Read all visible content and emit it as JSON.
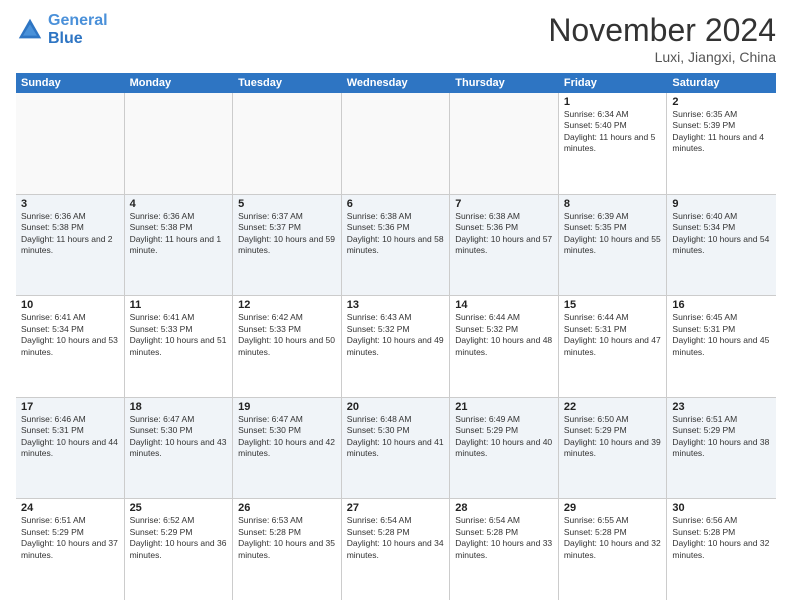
{
  "logo": {
    "line1": "General",
    "line2": "Blue"
  },
  "title": "November 2024",
  "location": "Luxi, Jiangxi, China",
  "weekdays": [
    "Sunday",
    "Monday",
    "Tuesday",
    "Wednesday",
    "Thursday",
    "Friday",
    "Saturday"
  ],
  "rows": [
    [
      {
        "day": "",
        "info": "",
        "empty": true
      },
      {
        "day": "",
        "info": "",
        "empty": true
      },
      {
        "day": "",
        "info": "",
        "empty": true
      },
      {
        "day": "",
        "info": "",
        "empty": true
      },
      {
        "day": "",
        "info": "",
        "empty": true
      },
      {
        "day": "1",
        "info": "Sunrise: 6:34 AM\nSunset: 5:40 PM\nDaylight: 11 hours and 5 minutes."
      },
      {
        "day": "2",
        "info": "Sunrise: 6:35 AM\nSunset: 5:39 PM\nDaylight: 11 hours and 4 minutes."
      }
    ],
    [
      {
        "day": "3",
        "info": "Sunrise: 6:36 AM\nSunset: 5:38 PM\nDaylight: 11 hours and 2 minutes."
      },
      {
        "day": "4",
        "info": "Sunrise: 6:36 AM\nSunset: 5:38 PM\nDaylight: 11 hours and 1 minute."
      },
      {
        "day": "5",
        "info": "Sunrise: 6:37 AM\nSunset: 5:37 PM\nDaylight: 10 hours and 59 minutes."
      },
      {
        "day": "6",
        "info": "Sunrise: 6:38 AM\nSunset: 5:36 PM\nDaylight: 10 hours and 58 minutes."
      },
      {
        "day": "7",
        "info": "Sunrise: 6:38 AM\nSunset: 5:36 PM\nDaylight: 10 hours and 57 minutes."
      },
      {
        "day": "8",
        "info": "Sunrise: 6:39 AM\nSunset: 5:35 PM\nDaylight: 10 hours and 55 minutes."
      },
      {
        "day": "9",
        "info": "Sunrise: 6:40 AM\nSunset: 5:34 PM\nDaylight: 10 hours and 54 minutes."
      }
    ],
    [
      {
        "day": "10",
        "info": "Sunrise: 6:41 AM\nSunset: 5:34 PM\nDaylight: 10 hours and 53 minutes."
      },
      {
        "day": "11",
        "info": "Sunrise: 6:41 AM\nSunset: 5:33 PM\nDaylight: 10 hours and 51 minutes."
      },
      {
        "day": "12",
        "info": "Sunrise: 6:42 AM\nSunset: 5:33 PM\nDaylight: 10 hours and 50 minutes."
      },
      {
        "day": "13",
        "info": "Sunrise: 6:43 AM\nSunset: 5:32 PM\nDaylight: 10 hours and 49 minutes."
      },
      {
        "day": "14",
        "info": "Sunrise: 6:44 AM\nSunset: 5:32 PM\nDaylight: 10 hours and 48 minutes."
      },
      {
        "day": "15",
        "info": "Sunrise: 6:44 AM\nSunset: 5:31 PM\nDaylight: 10 hours and 47 minutes."
      },
      {
        "day": "16",
        "info": "Sunrise: 6:45 AM\nSunset: 5:31 PM\nDaylight: 10 hours and 45 minutes."
      }
    ],
    [
      {
        "day": "17",
        "info": "Sunrise: 6:46 AM\nSunset: 5:31 PM\nDaylight: 10 hours and 44 minutes."
      },
      {
        "day": "18",
        "info": "Sunrise: 6:47 AM\nSunset: 5:30 PM\nDaylight: 10 hours and 43 minutes."
      },
      {
        "day": "19",
        "info": "Sunrise: 6:47 AM\nSunset: 5:30 PM\nDaylight: 10 hours and 42 minutes."
      },
      {
        "day": "20",
        "info": "Sunrise: 6:48 AM\nSunset: 5:30 PM\nDaylight: 10 hours and 41 minutes."
      },
      {
        "day": "21",
        "info": "Sunrise: 6:49 AM\nSunset: 5:29 PM\nDaylight: 10 hours and 40 minutes."
      },
      {
        "day": "22",
        "info": "Sunrise: 6:50 AM\nSunset: 5:29 PM\nDaylight: 10 hours and 39 minutes."
      },
      {
        "day": "23",
        "info": "Sunrise: 6:51 AM\nSunset: 5:29 PM\nDaylight: 10 hours and 38 minutes."
      }
    ],
    [
      {
        "day": "24",
        "info": "Sunrise: 6:51 AM\nSunset: 5:29 PM\nDaylight: 10 hours and 37 minutes."
      },
      {
        "day": "25",
        "info": "Sunrise: 6:52 AM\nSunset: 5:29 PM\nDaylight: 10 hours and 36 minutes."
      },
      {
        "day": "26",
        "info": "Sunrise: 6:53 AM\nSunset: 5:28 PM\nDaylight: 10 hours and 35 minutes."
      },
      {
        "day": "27",
        "info": "Sunrise: 6:54 AM\nSunset: 5:28 PM\nDaylight: 10 hours and 34 minutes."
      },
      {
        "day": "28",
        "info": "Sunrise: 6:54 AM\nSunset: 5:28 PM\nDaylight: 10 hours and 33 minutes."
      },
      {
        "day": "29",
        "info": "Sunrise: 6:55 AM\nSunset: 5:28 PM\nDaylight: 10 hours and 32 minutes."
      },
      {
        "day": "30",
        "info": "Sunrise: 6:56 AM\nSunset: 5:28 PM\nDaylight: 10 hours and 32 minutes."
      }
    ]
  ]
}
